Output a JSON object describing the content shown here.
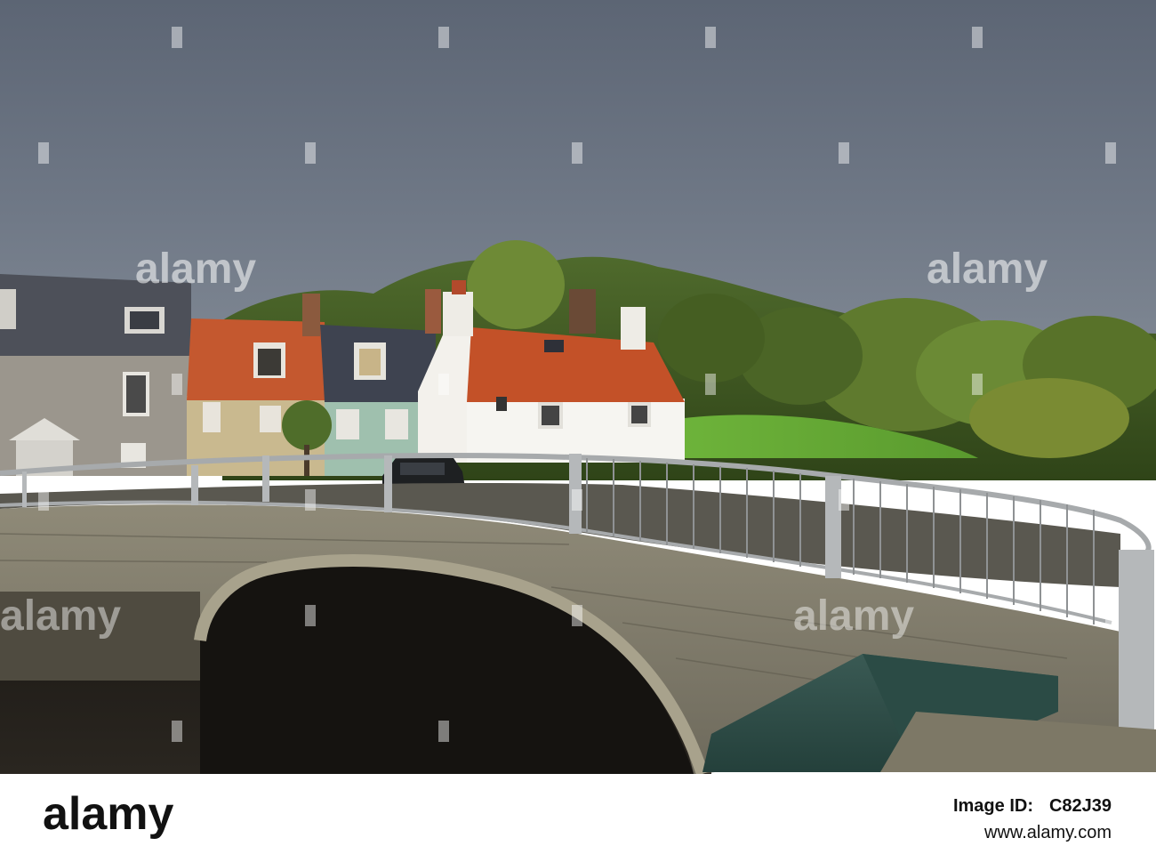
{
  "watermark": {
    "brand": "alamy"
  },
  "footer": {
    "logo_text": "alamy",
    "image_id_label": "Image ID:",
    "image_id": "C82J39",
    "url": "www.alamy.com"
  }
}
